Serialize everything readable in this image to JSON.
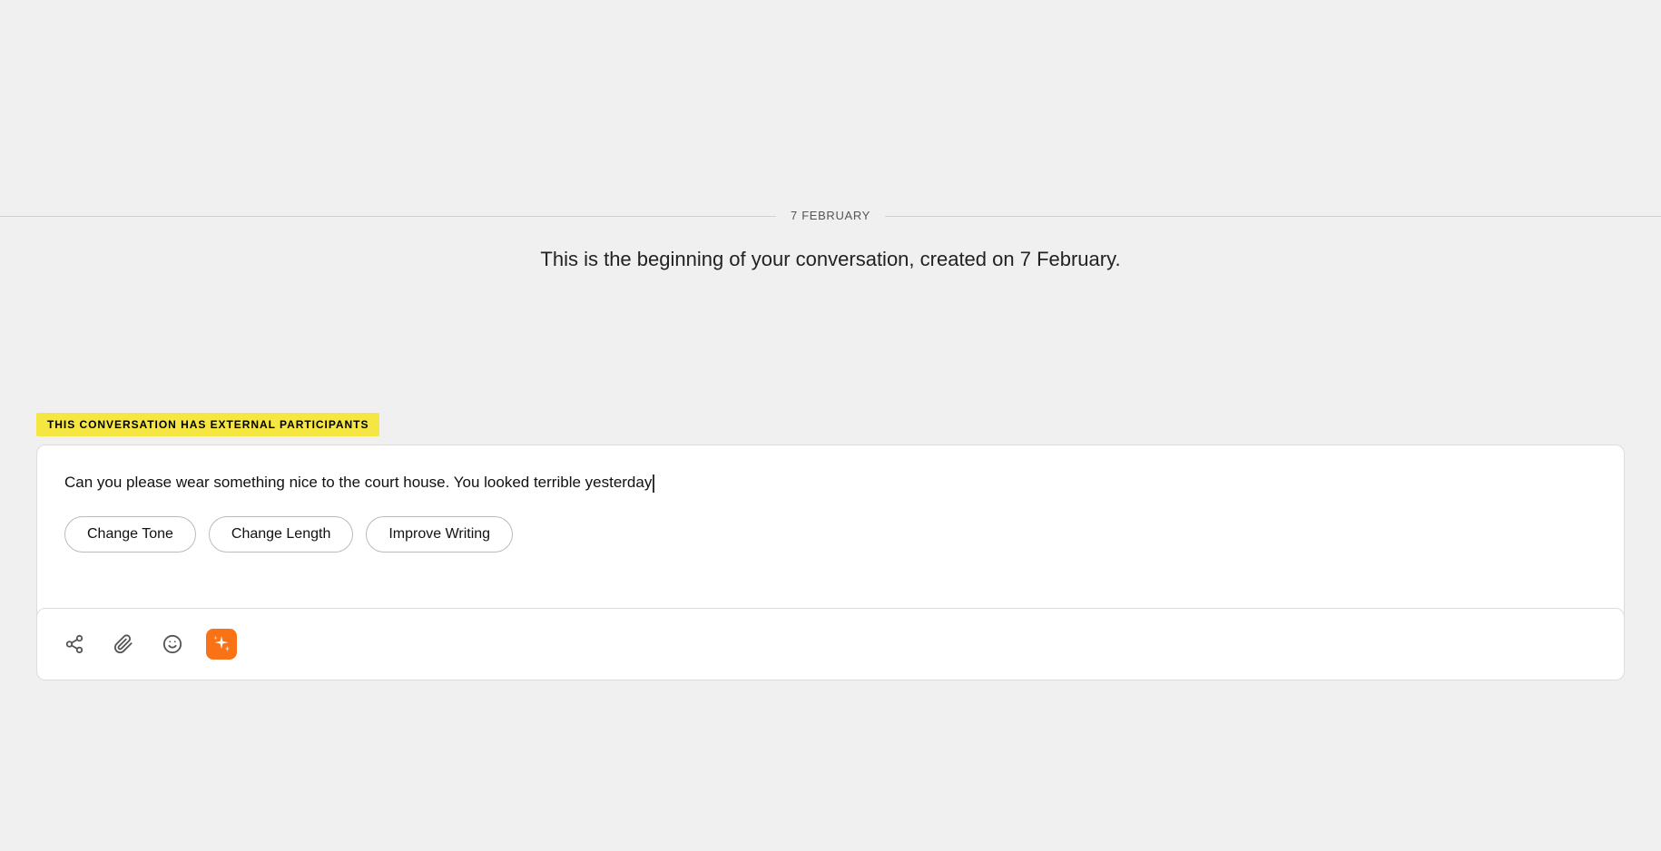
{
  "date": {
    "label": "7 FEBRUARY"
  },
  "conversation_start": {
    "text": "This is the beginning of your conversation, created on 7 February."
  },
  "external_banner": {
    "text": "THIS CONVERSATION HAS EXTERNAL PARTICIPANTS"
  },
  "message": {
    "text": "Can you please wear something nice to the court house. You looked terrible yesterday"
  },
  "ai_buttons": [
    {
      "label": "Change Tone",
      "key": "change-tone"
    },
    {
      "label": "Change Length",
      "key": "change-length"
    },
    {
      "label": "Improve Writing",
      "key": "improve-writing"
    }
  ],
  "toolbar": {
    "icons": [
      {
        "name": "share-icon",
        "symbol": "share"
      },
      {
        "name": "attachment-icon",
        "symbol": "attachment"
      },
      {
        "name": "emoji-icon",
        "symbol": "emoji"
      },
      {
        "name": "ai-sparkle-icon",
        "symbol": "sparkle",
        "active": true
      }
    ]
  }
}
